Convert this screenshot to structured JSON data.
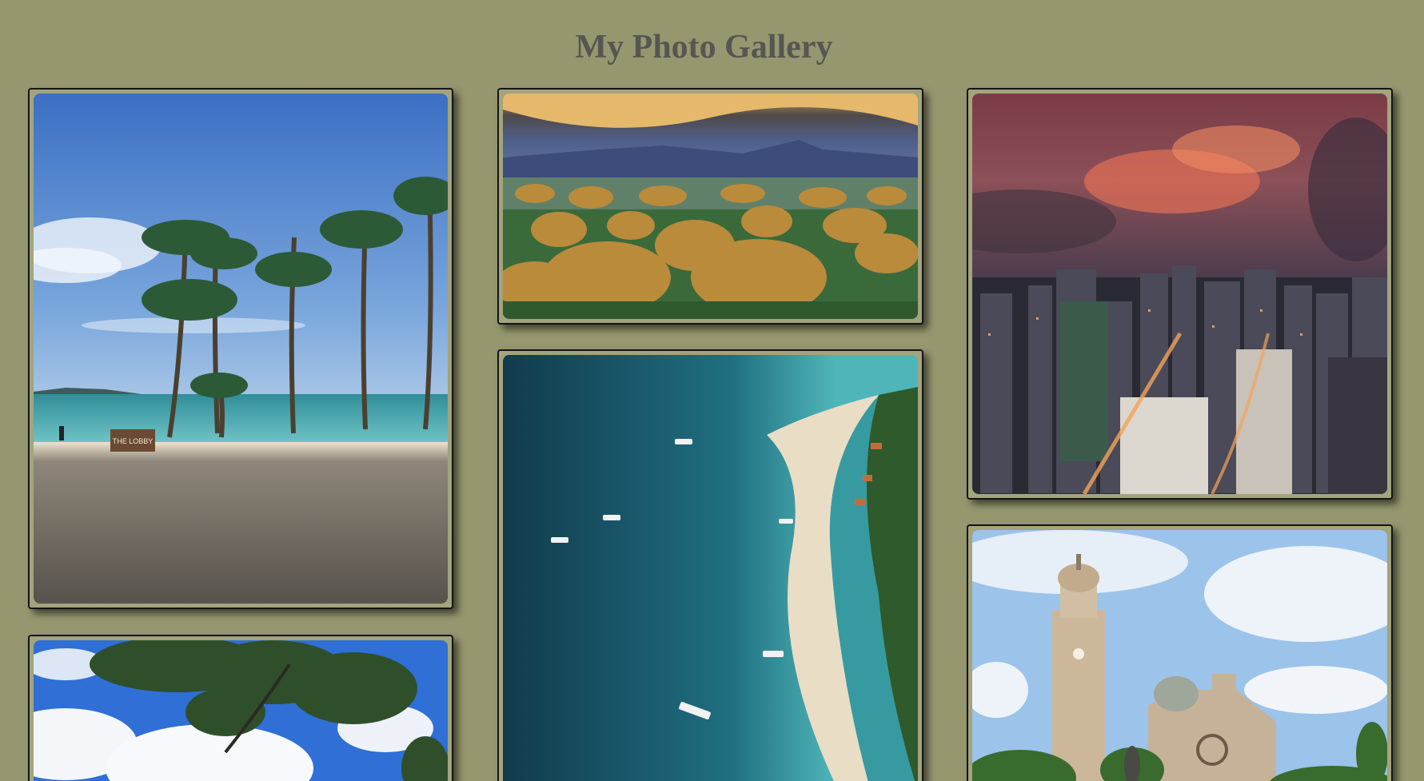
{
  "page": {
    "title": "My Photo Gallery"
  },
  "colors": {
    "background": "#96976f",
    "title": "#575651",
    "card_border": "#141414"
  },
  "photos": [
    {
      "subject": "beach-palm-trees",
      "sign_text": "THE LOBBY"
    },
    {
      "subject": "chocolate-hills-landscape"
    },
    {
      "subject": "city-skyline-sunset"
    },
    {
      "subject": "palm-leaves-sky"
    },
    {
      "subject": "aerial-beach-boats"
    },
    {
      "subject": "cathedral-bell-tower"
    }
  ]
}
